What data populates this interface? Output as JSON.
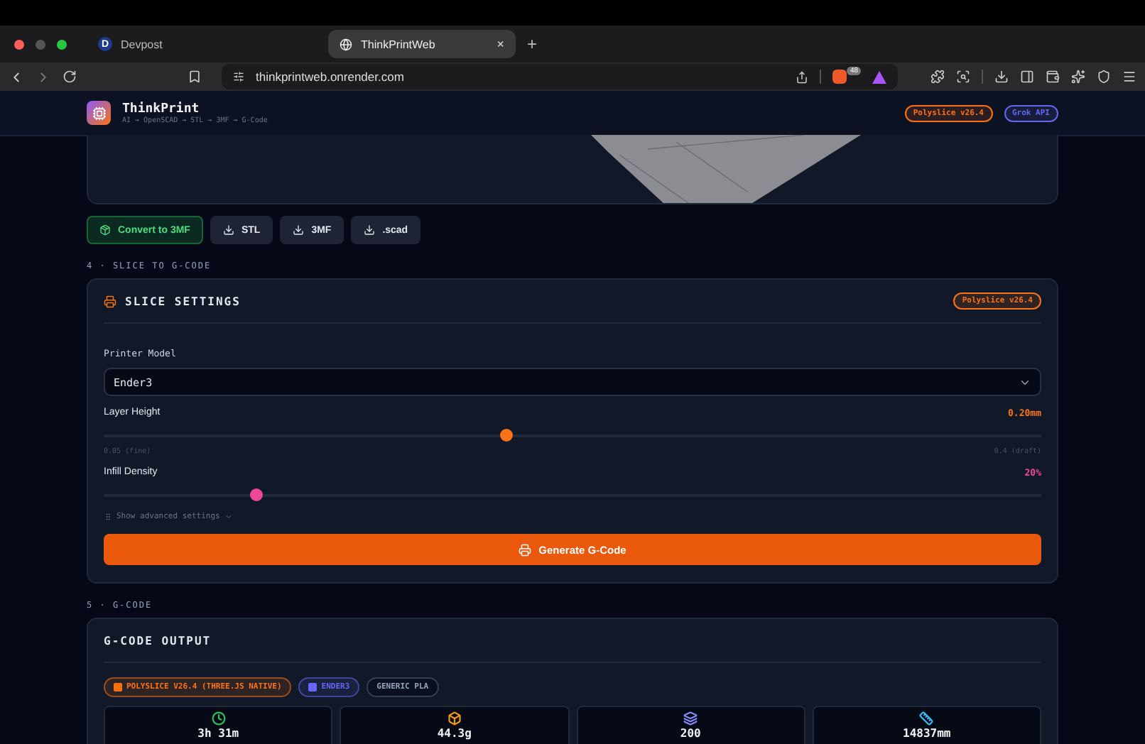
{
  "browser": {
    "tabs": [
      {
        "title": "Devpost",
        "letter": "D",
        "selected": false
      },
      {
        "title": "ThinkPrintWeb",
        "selected": true,
        "close": "×"
      }
    ],
    "new_tab": "+",
    "url": "thinkprintweb.onrender.com",
    "shield_count": "48"
  },
  "header": {
    "title": "ThinkPrint",
    "subtitle": "AI → OpenSCAD → STL → 3MF → G-Code",
    "badges": [
      {
        "label": "Polyslice v26.4",
        "color": "#f97316"
      },
      {
        "label": "Grok API",
        "color": "#6366f1"
      }
    ]
  },
  "export_buttons": [
    {
      "label": "Convert to 3MF",
      "kind": "primary"
    },
    {
      "label": "STL",
      "kind": "download"
    },
    {
      "label": "3MF",
      "kind": "download"
    },
    {
      "label": ".scad",
      "kind": "download"
    }
  ],
  "slice_section": {
    "heading": "4 · SLICE TO G-CODE",
    "title": "SLICE SETTINGS",
    "badge": "Polyslice v26.4",
    "printer_model": {
      "label": "Printer Model",
      "value": "Ender3"
    },
    "sliders": [
      {
        "label": "Layer Height",
        "reading": "0.20mm",
        "level": 0.43,
        "color": "#f97316",
        "min_label": "0.05 (fine)",
        "max_label": "0.4 (draft)"
      },
      {
        "label": "Infill Density",
        "reading": "20%",
        "level": 0.163,
        "color": "#ec4899"
      }
    ],
    "advanced_toggle": "Show advanced settings",
    "generate_button": "Generate G-Code"
  },
  "output_section": {
    "heading": "5 · G-CODE",
    "title": "G-CODE OUTPUT",
    "tags": [
      {
        "label": "POLYSLICE V26.4 (THREE.JS NATIVE)",
        "color": "#f97316",
        "kind": "engine"
      },
      {
        "label": "ENDER3",
        "color": "#6366f1",
        "kind": "printer"
      },
      {
        "label": "GENERIC PLA",
        "color": "#94a3b8",
        "kind": "plain"
      }
    ],
    "stats": [
      {
        "kind": "time",
        "value": "3h 31m",
        "color": "#22c55e"
      },
      {
        "kind": "weight",
        "value": "44.3g",
        "color": "#f59e0b"
      },
      {
        "kind": "layers",
        "value": "200",
        "color": "#818cf8"
      },
      {
        "kind": "length",
        "value": "14837mm",
        "color": "#38bdf8"
      }
    ]
  }
}
